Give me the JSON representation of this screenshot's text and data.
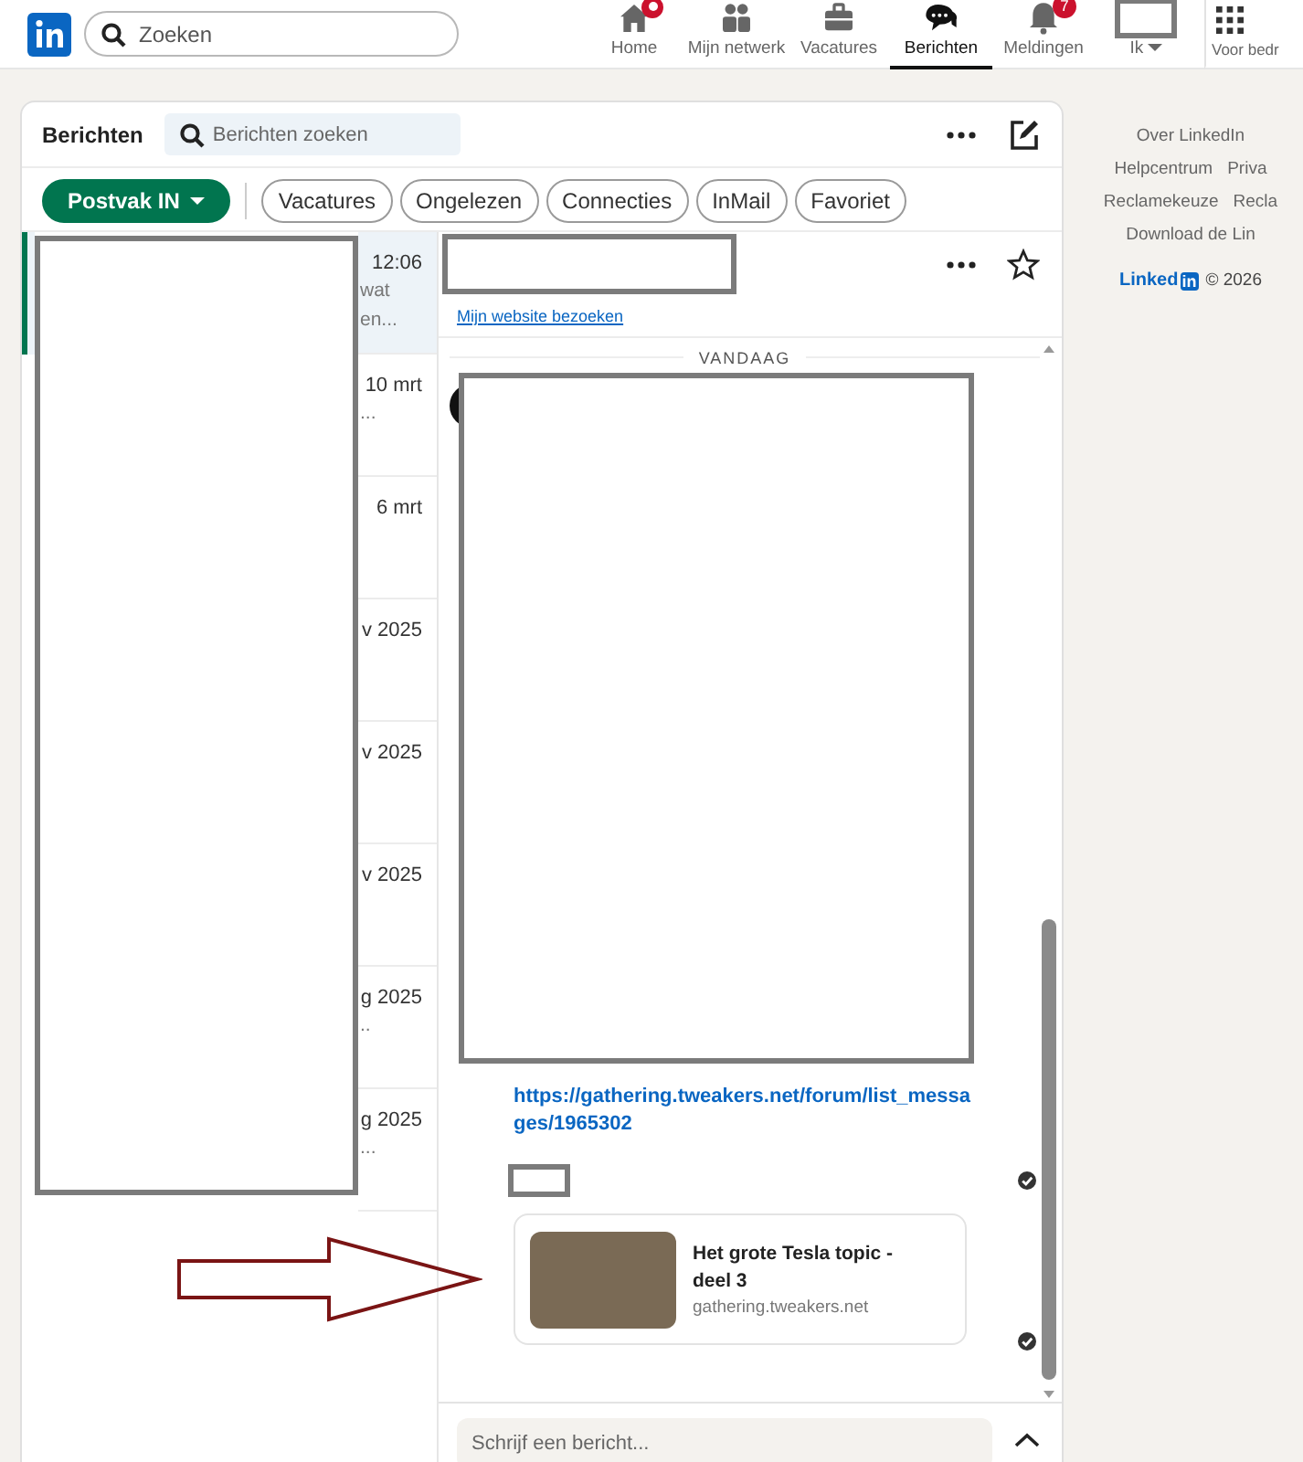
{
  "nav": {
    "search": {
      "placeholder": "Zoeken"
    },
    "items": [
      {
        "kind": "home",
        "label": "Home",
        "selected": false,
        "dot": true
      },
      {
        "kind": "network",
        "label": "Mijn netwerk",
        "selected": false,
        "dot": false
      },
      {
        "kind": "jobs",
        "label": "Vacatures",
        "selected": false,
        "dot": false
      },
      {
        "kind": "messages",
        "label": "Berichten",
        "selected": true,
        "dot": false
      },
      {
        "kind": "notifications",
        "label": "Meldingen",
        "selected": false,
        "dot": false,
        "badge": "7"
      },
      {
        "kind": "me",
        "label": "Ik",
        "selected": false,
        "dot": false
      },
      {
        "kind": "business",
        "label": "Voor bedr",
        "selected": false,
        "dot": false
      }
    ]
  },
  "messaging": {
    "title": "Berichten",
    "search": {
      "placeholder": "Berichten zoeken"
    },
    "filters": [
      {
        "label": "Postvak IN",
        "selected": true,
        "dropdown": true
      },
      {
        "label": "Vacatures",
        "selected": false,
        "dropdown": false
      },
      {
        "label": "Ongelezen",
        "selected": false,
        "dropdown": false
      },
      {
        "label": "Connecties",
        "selected": false,
        "dropdown": false
      },
      {
        "label": "InMail",
        "selected": false,
        "dropdown": false
      },
      {
        "label": "Favoriet",
        "selected": false,
        "dropdown": false
      }
    ],
    "conversations": [
      {
        "time": "12:06",
        "preview": [
          "wat",
          "en..."
        ],
        "selected": true
      },
      {
        "time": "10 mrt",
        "preview": [
          "..."
        ],
        "selected": false
      },
      {
        "time": "6 mrt",
        "selected": false
      },
      {
        "time": "v 2025",
        "selected": false
      },
      {
        "time": "v 2025",
        "selected": false
      },
      {
        "time": "v 2025",
        "selected": false
      },
      {
        "time": "g 2025",
        "preview": [
          ".."
        ],
        "selected": false
      },
      {
        "time": "g 2025",
        "preview": [
          "..."
        ],
        "selected": false
      }
    ],
    "thread": {
      "profile_link": "Mijn website bezoeken",
      "day_divider": "VANDAAG",
      "message_link": "https://gathering.tweakers.net/forum/list_messages/1965302",
      "link_preview": {
        "title": "Het grote Tesla topic - deel 3",
        "domain": "gathering.tweakers.net"
      },
      "compose": {
        "placeholder": "Schrijf een bericht..."
      }
    }
  },
  "footer": {
    "rows": [
      [
        "Over LinkedIn"
      ],
      [
        "Helpcentrum",
        "Priva"
      ],
      [
        "Reclamekeuze",
        "Recla"
      ],
      [
        "Download de Lin"
      ]
    ],
    "logo": {
      "word": "Linked",
      "box": "in"
    },
    "copyright": "© 2026"
  }
}
